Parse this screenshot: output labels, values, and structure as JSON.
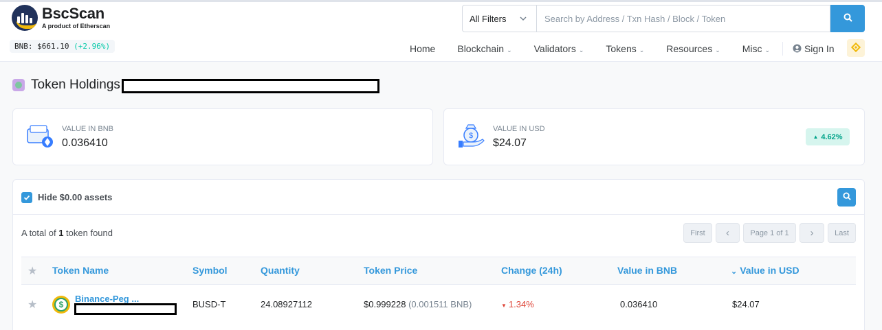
{
  "brand": {
    "name": "BscScan",
    "tagline": "A product of Etherscan",
    "price_label": "BNB: $661.10",
    "price_change": "(+2.96%)"
  },
  "search": {
    "filter_label": "All Filters",
    "placeholder": "Search by Address / Txn Hash / Block / Token"
  },
  "nav": {
    "home": "Home",
    "blockchain": "Blockchain",
    "validators": "Validators",
    "tokens": "Tokens",
    "resources": "Resources",
    "misc": "Misc",
    "sign_in": "Sign In"
  },
  "page": {
    "title": "Token Holdings"
  },
  "stats": {
    "bnb_label": "VALUE IN BNB",
    "bnb_value": "0.036410",
    "usd_label": "VALUE IN USD",
    "usd_value": "$24.07",
    "change": "4.62%"
  },
  "holdings": {
    "hide_zero_label": "Hide $0.00 assets",
    "total_prefix": "A total of ",
    "total_count": "1",
    "total_suffix": " token found",
    "pagination": {
      "first": "First",
      "prev": "‹",
      "page": "Page 1 of 1",
      "next": "›",
      "last": "Last"
    },
    "columns": {
      "token_name": "Token Name",
      "symbol": "Symbol",
      "quantity": "Quantity",
      "token_price": "Token Price",
      "change": "Change (24h)",
      "value_bnb": "Value in BNB",
      "value_usd": "Value in USD"
    },
    "rows": [
      {
        "token_name": "Binance-Peg ...",
        "symbol": "BUSD-T",
        "quantity": "24.08927112",
        "price": "$0.999228",
        "price_bnb": "(0.001511 BNB)",
        "change": "1.34%",
        "value_bnb": "0.036410",
        "value_usd": "$24.07"
      }
    ]
  },
  "colors": {
    "accent": "#3498db",
    "positive": "#00c9a7",
    "negative": "#de4437",
    "brand_gold": "#f0b90b",
    "brand_navy": "#21325b"
  },
  "icons": [
    "logo-icon",
    "chevron-down-icon",
    "search-icon",
    "user-circle-icon",
    "bnb-diamond-icon",
    "token-icon",
    "wallet-icon",
    "money-bag-icon",
    "caret-up-icon",
    "check-icon",
    "star-icon",
    "caret-down-icon",
    "sort-down-icon",
    "coin-icon"
  ]
}
